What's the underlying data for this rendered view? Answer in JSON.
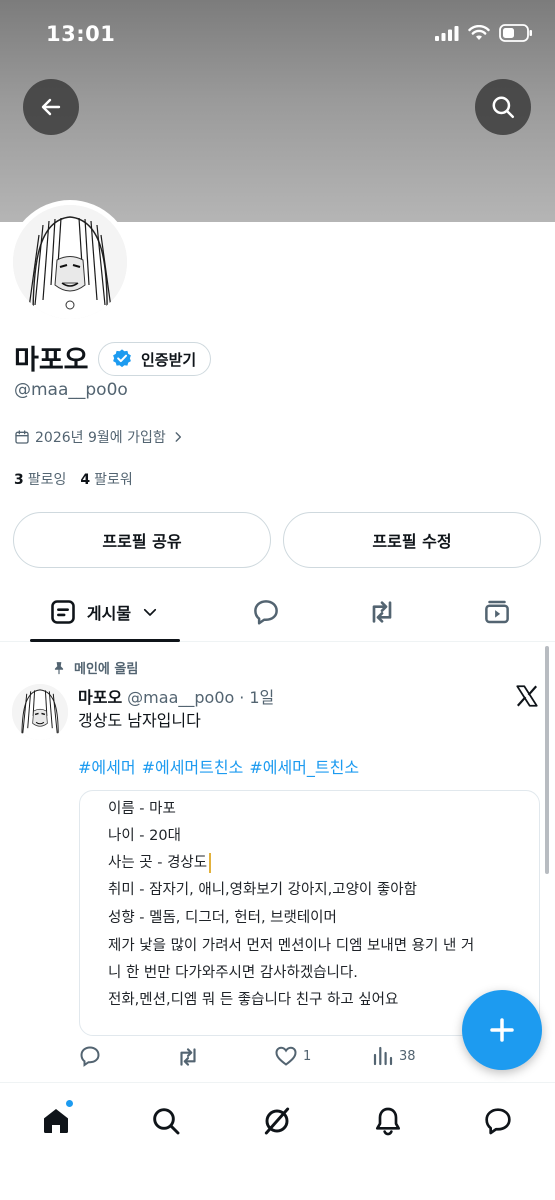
{
  "status": {
    "time": "13:01"
  },
  "profile": {
    "name": "마포오",
    "verify_label": "인증받기",
    "handle": "@maa__po0o",
    "joined": "2026년 9월에 가입함",
    "following_count": "3",
    "following_label": "팔로잉",
    "followers_count": "4",
    "followers_label": "팔로워"
  },
  "buttons": {
    "share": "프로필 공유",
    "edit": "프로필 수정"
  },
  "tabs": {
    "posts": "게시물"
  },
  "post": {
    "pinned": "메인에 올림",
    "name": "마포오",
    "handle": "@maa__po0o",
    "sep": "·",
    "age": "1일",
    "text": "갱상도 남자입니다",
    "tags": [
      "#에세머",
      "#에세머트친소",
      "#에세머_트친소"
    ],
    "card_lines": [
      "이름 - 마포",
      "나이 - 20대",
      "사는 곳 - 경상도",
      "취미 - 잠자기, 애니,영화보기 강아지,고양이 좋아함",
      "성향 - 멜돔, 디그더, 헌터, 브랫테이머",
      "제가 낯을 많이 가려서 먼저 멘션이나 디엠 보내면 용기 낸 거",
      "니 한 번만 다가와주시면 감사하겠습니다.",
      "전화,멘션,디엠 뭐 든 좋습니다 친구 하고 싶어요"
    ],
    "likes": "1",
    "views": "38"
  },
  "colors": {
    "accent": "#1d9bf0",
    "text": "#0f1419",
    "muted": "#536471",
    "border": "#cfd9de"
  },
  "icons": [
    "back-arrow-icon",
    "search-icon",
    "verified-badge-icon",
    "calendar-icon",
    "pin-icon",
    "x-logo-icon",
    "reply-icon",
    "retweet-icon",
    "like-icon",
    "views-icon",
    "compose-plus-icon",
    "home-icon",
    "grok-icon",
    "bell-icon",
    "messages-icon"
  ]
}
